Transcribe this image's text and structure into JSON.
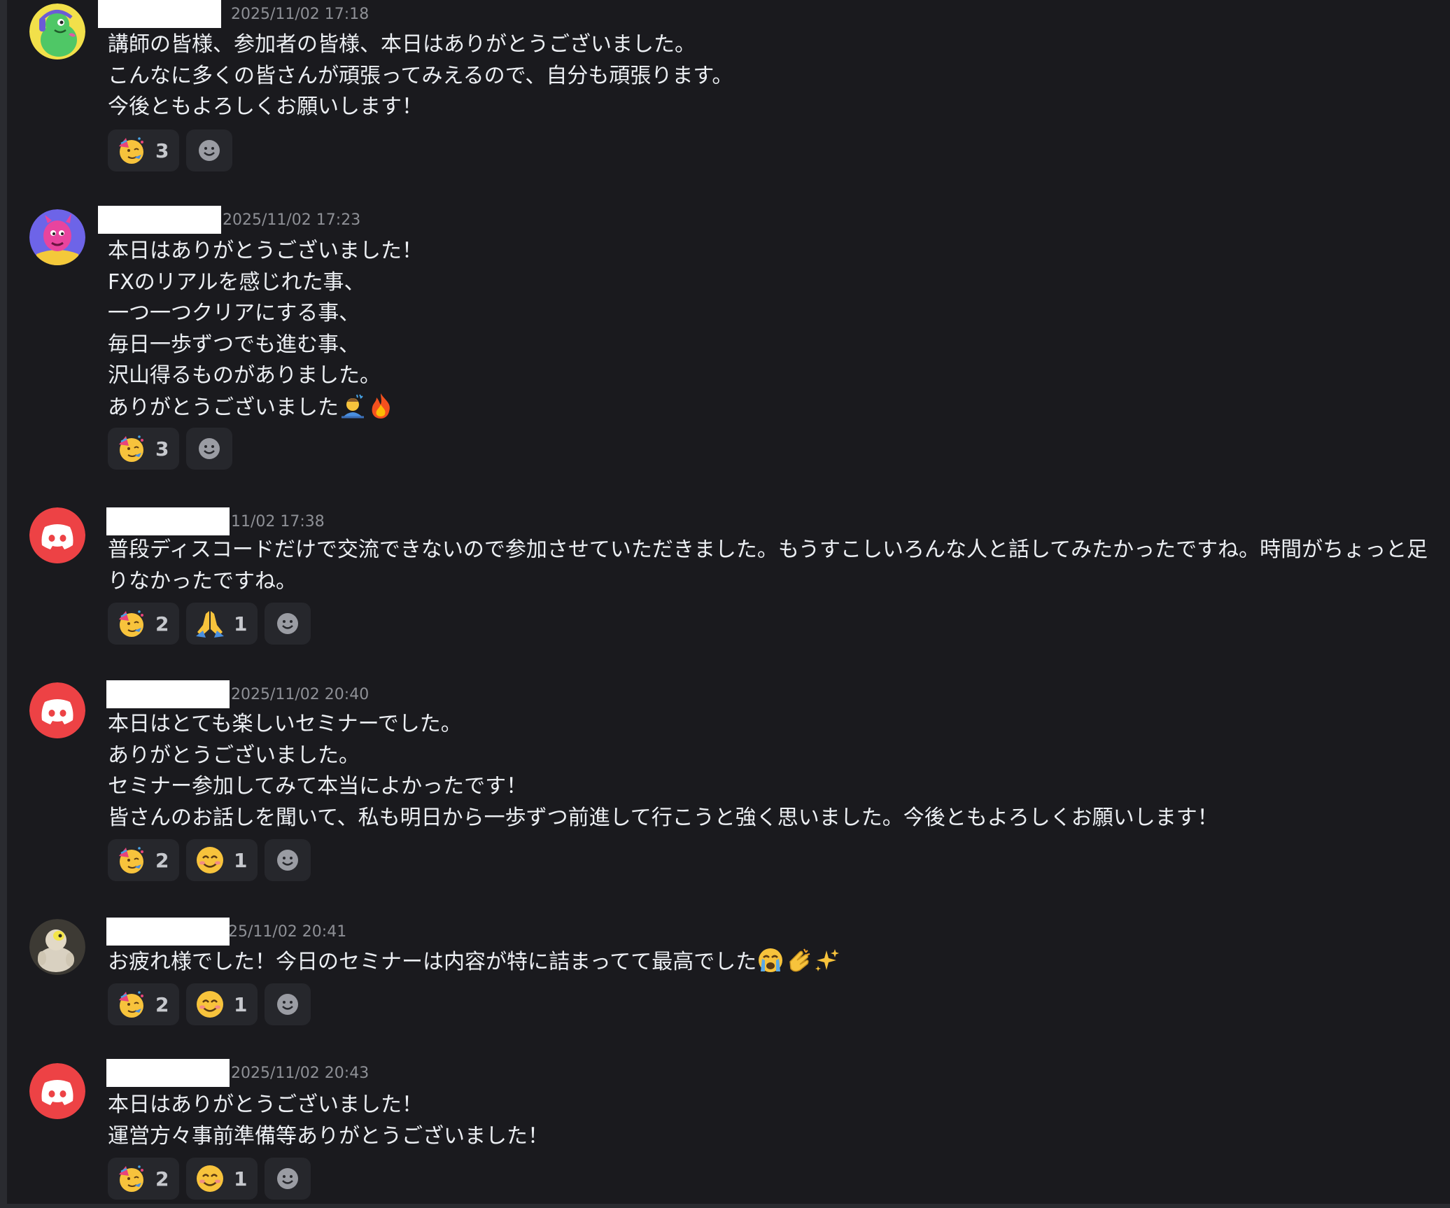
{
  "messages": [
    {
      "timestamp": "2025/11/02 17:18",
      "lines": [
        "講師の皆様、参加者の皆様、本日はありがとうございました。",
        "こんなに多くの皆さんが頑張ってみえるので、自分も頑張ります。",
        "今後ともよろしくお願いします！"
      ],
      "reactions": [
        {
          "emoji": "partying-face",
          "count": "3"
        }
      ]
    },
    {
      "timestamp": "2025/11/02 17:23",
      "lines": [
        "本日はありがとうございました！",
        "FXのリアルを感じれた事、",
        "一つ一つクリアにする事、",
        "毎日一歩ずつでも進む事、",
        "沢山得るものがありました。",
        "ありがとうございました"
      ],
      "reactions": [
        {
          "emoji": "partying-face",
          "count": "3"
        }
      ]
    },
    {
      "timestamp": "11/02 17:38",
      "text": "普段ディスコードだけで交流できないので参加させていただきました。もうすこしいろんな人と話してみたかったですね。時間がちょっと足りなかったですね。",
      "reactions": [
        {
          "emoji": "partying-face",
          "count": "2"
        },
        {
          "emoji": "folded-hands",
          "count": "1"
        }
      ]
    },
    {
      "timestamp": "2025/11/02 20:40",
      "lines": [
        "本日はとても楽しいセミナーでした。",
        "ありがとうございました。",
        "セミナー参加してみて本当によかったです！",
        "皆さんのお話しを聞いて、私も明日から一歩ずつ前進して行こうと強く思いました。今後ともよろしくお願いします！"
      ],
      "reactions": [
        {
          "emoji": "partying-face",
          "count": "2"
        },
        {
          "emoji": "smiling-face",
          "count": "1"
        }
      ]
    },
    {
      "timestamp": "25/11/02 20:41",
      "lines": [
        "お疲れ様でした！今日のセミナーは内容が特に詰まってて最高でした"
      ],
      "reactions": [
        {
          "emoji": "partying-face",
          "count": "2"
        },
        {
          "emoji": "smiling-face",
          "count": "1"
        }
      ]
    },
    {
      "timestamp": "2025/11/02 20:43",
      "lines": [
        "本日はありがとうございました！",
        "運営方々事前準備等ありがとうございました！"
      ],
      "reactions": [
        {
          "emoji": "partying-face",
          "count": "2"
        },
        {
          "emoji": "smiling-face",
          "count": "1"
        }
      ]
    }
  ],
  "colors": {
    "background": "#1a1a1e",
    "reaction_bg": "#26272c",
    "discord_red": "#ed4245",
    "timestamp": "#8e9096",
    "text": "#eceff3"
  }
}
